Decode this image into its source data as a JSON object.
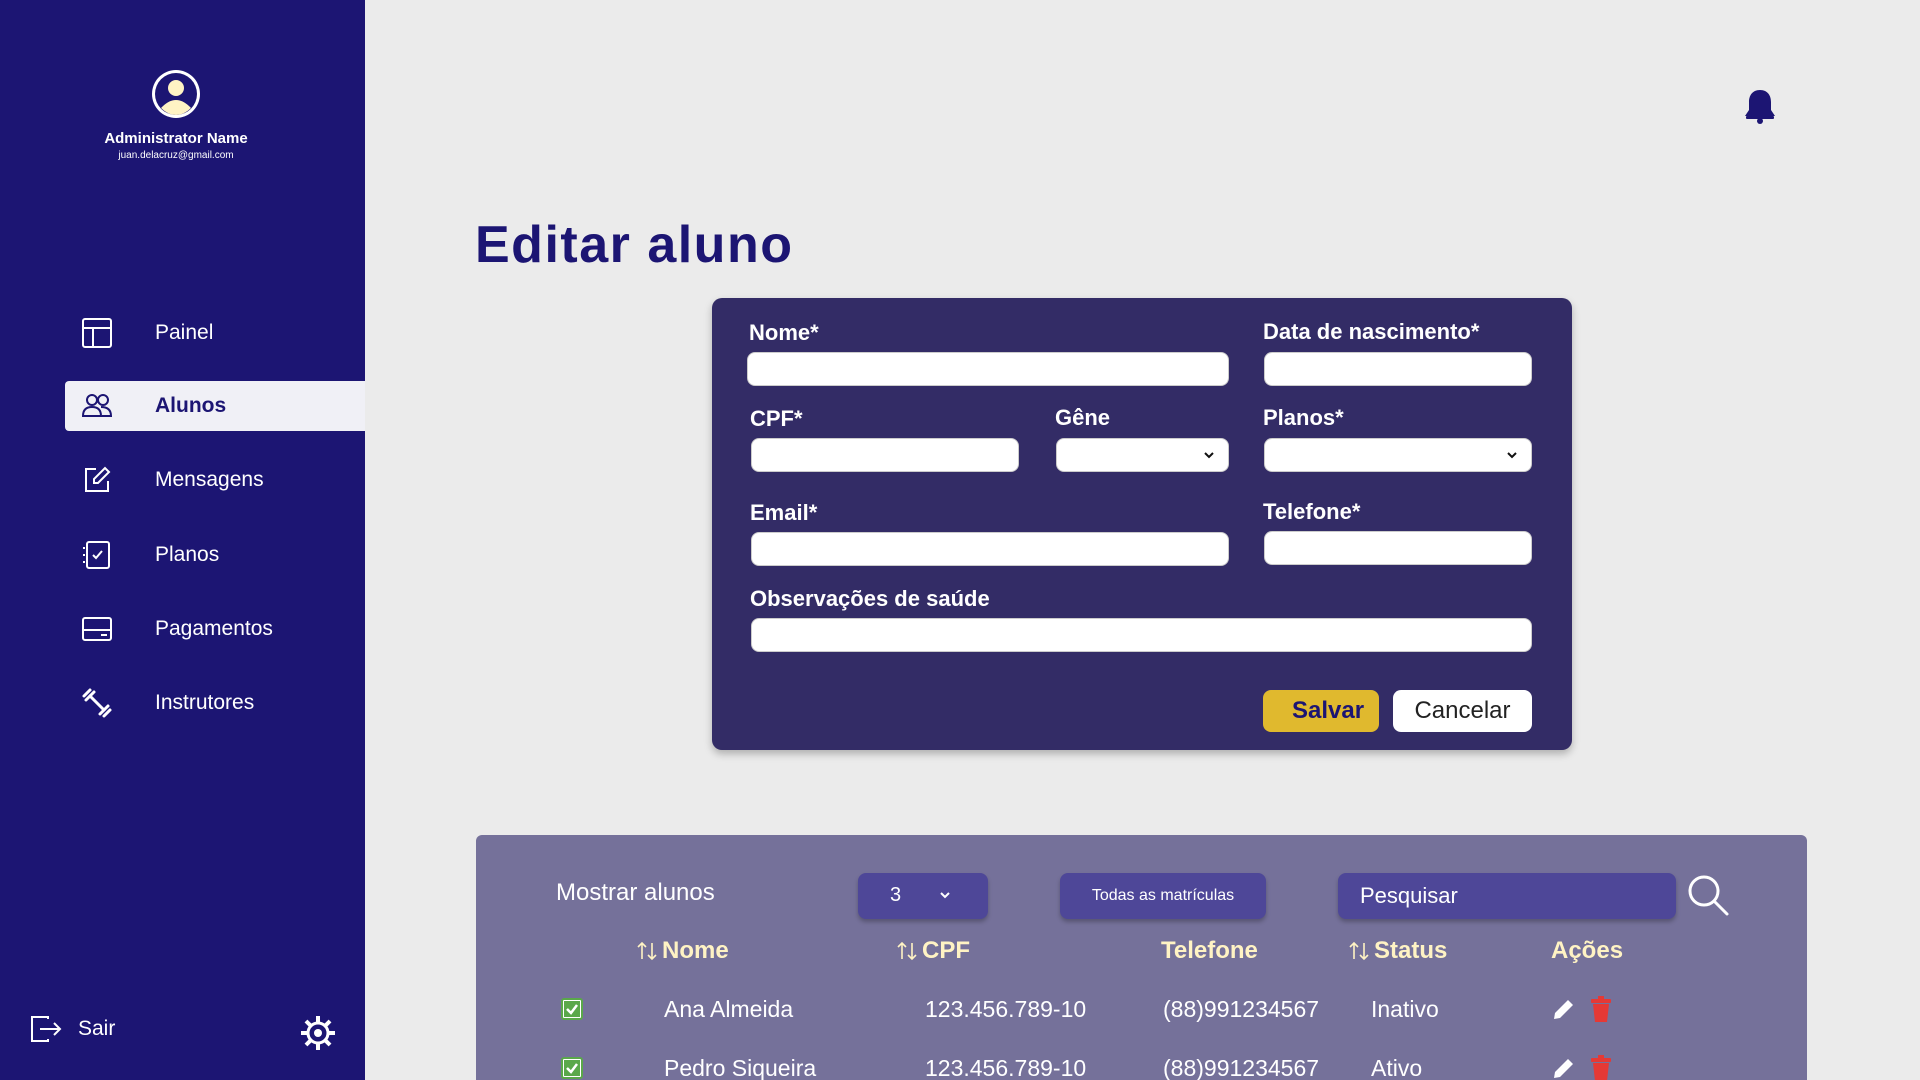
{
  "profile": {
    "name": "Administrator Name",
    "email": "juan.delacruz@gmail.com"
  },
  "nav": {
    "items": [
      {
        "label": "Painel",
        "icon": "layout-icon"
      },
      {
        "label": "Alunos",
        "icon": "users-icon",
        "active": true
      },
      {
        "label": "Mensagens",
        "icon": "edit-icon"
      },
      {
        "label": "Planos",
        "icon": "checklist-icon"
      },
      {
        "label": "Pagamentos",
        "icon": "card-icon"
      },
      {
        "label": "Instrutores",
        "icon": "dumbbell-icon"
      }
    ],
    "logout": "Sair"
  },
  "page": {
    "title": "Editar aluno"
  },
  "form": {
    "nome_label": "Nome*",
    "nascimento_label": "Data de nascimento*",
    "cpf_label": "CPF*",
    "genero_label": "Gêne",
    "planos_label": "Planos*",
    "email_label": "Email*",
    "telefone_label": "Telefone*",
    "obs_label": "Observações de saúde",
    "save": "Salvar",
    "cancel": "Cancelar"
  },
  "table": {
    "show_label": "Mostrar alunos",
    "count": "3",
    "filter": "Todas as matrículas",
    "search_placeholder": "Pesquisar",
    "headers": [
      "Nome",
      "CPF",
      "Telefone",
      "Status",
      "Ações"
    ],
    "rows": [
      {
        "nome": "Ana Almeida",
        "cpf": "123.456.789-10",
        "telefone": "(88)991234567",
        "status": "Inativo"
      },
      {
        "nome": "Pedro Siqueira",
        "cpf": "123.456.789-10",
        "telefone": "(88)991234567",
        "status": "Ativo"
      }
    ]
  },
  "colors": {
    "sidebar": "#1c1573",
    "form_card": "#332c66",
    "save_button": "#e0b92e",
    "table_panel": "#75719a",
    "header_text": "#fff3c4",
    "delete": "#e53935"
  }
}
